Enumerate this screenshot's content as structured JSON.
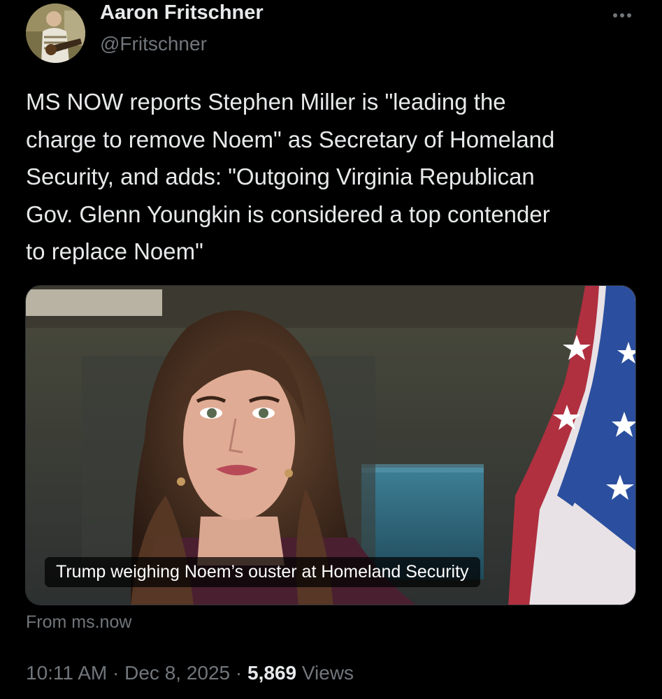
{
  "author": {
    "display_name": "Aaron Fritschner",
    "handle": "@Fritschner"
  },
  "tweet": {
    "text": "MS NOW reports Stephen Miller is \"leading the\ncharge to remove Noem\" as Secretary of Homeland\nSecurity, and adds: \"Outgoing Virginia Republican\nGov. Glenn Youngkin is considered a top contender\nto replace Noem\""
  },
  "link_card": {
    "title": "Trump weighing Noem’s ouster at Homeland Security",
    "source": "From ms.now"
  },
  "meta": {
    "time": "10:11 AM",
    "separator": "·",
    "date": "Dec 8, 2025",
    "views_count": "5,869",
    "views_label": "Views"
  },
  "icons": {
    "more": "more-horizontal-icon"
  },
  "colors": {
    "background": "#000000",
    "primary_text": "#e7e9ea",
    "secondary_text": "#71767b"
  }
}
